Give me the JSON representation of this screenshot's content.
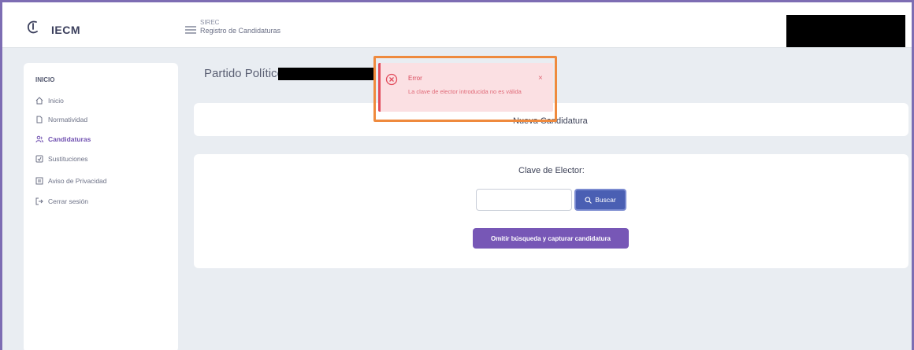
{
  "header": {
    "logo": "IECM",
    "app_line1": "SIREC",
    "app_line2": "Registro de Candidaturas"
  },
  "sidebar": {
    "section": "INICIO",
    "items": [
      {
        "label": "Inicio",
        "icon": "home-icon"
      },
      {
        "label": "Normatividad",
        "icon": "document-icon"
      },
      {
        "label": "Candidaturas",
        "icon": "users-icon",
        "active": true
      },
      {
        "label": "Sustituciones",
        "icon": "swap-icon"
      },
      {
        "label": "Aviso de Privacidad",
        "icon": "privacy-icon"
      },
      {
        "label": "Cerrar sesión",
        "icon": "logout-icon"
      }
    ]
  },
  "main": {
    "party_label": "Partido Político:",
    "card_title": "Nueva Candidatura",
    "clave_label": "Clave de Elector:",
    "clave_value": "",
    "search_button": "Buscar",
    "omit_button": "Omitir búsqueda y capturar candidatura"
  },
  "toast": {
    "title": "Error",
    "message": "La clave de elector introducida no es válida",
    "close": "×"
  },
  "colors": {
    "accent": "#7757b6",
    "error": "#e24c5c",
    "highlight": "#ef8a3e",
    "frame": "#7d6db3"
  }
}
